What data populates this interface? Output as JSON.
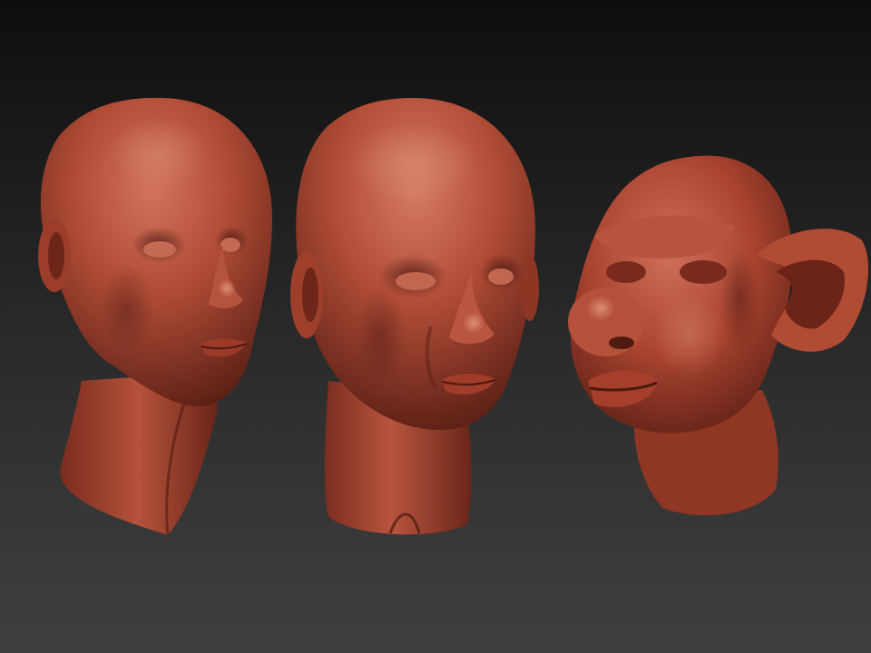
{
  "scene": {
    "background_top": "#0e0e0e",
    "background_bottom": "#3f3f3f",
    "clay_base": "#a8432f",
    "clay_highlight": "#d2735c",
    "clay_shadow": "#5a1f15",
    "models": [
      {
        "name": "head-left",
        "pose": "three-quarter-right",
        "style": "slender"
      },
      {
        "name": "head-center",
        "pose": "front",
        "style": "gaunt"
      },
      {
        "name": "head-right",
        "pose": "three-quarter-left",
        "style": "ogre"
      }
    ]
  }
}
